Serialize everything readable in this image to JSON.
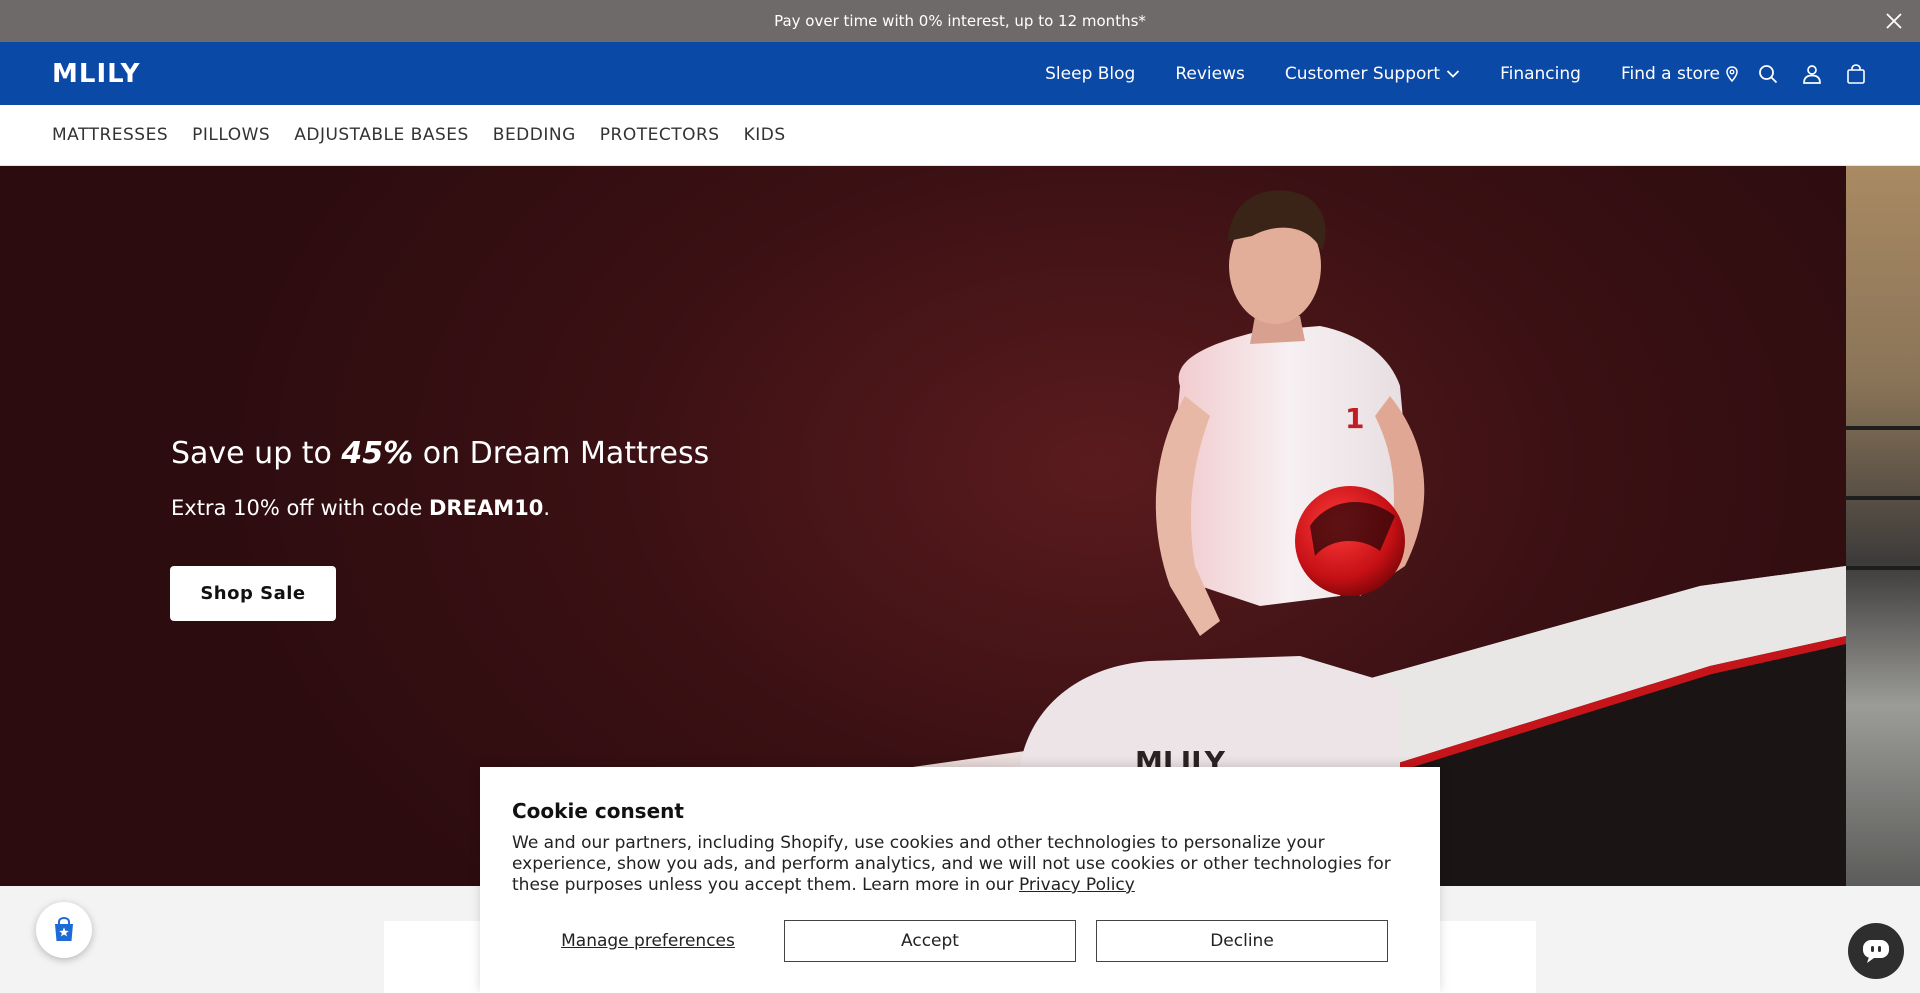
{
  "announcement": {
    "text": "Pay over time with 0% interest, up to 12 months*"
  },
  "brand": {
    "logo_text": "MLILY",
    "header_color": "#0b49a6"
  },
  "topnav": {
    "items": [
      {
        "label": "Sleep Blog"
      },
      {
        "label": "Reviews"
      },
      {
        "label": "Customer Support"
      },
      {
        "label": "Financing"
      },
      {
        "label": "Find a store"
      }
    ]
  },
  "categories": [
    "MATTRESSES",
    "PILLOWS",
    "ADJUSTABLE BASES",
    "BEDDING",
    "PROTECTORS",
    "KIDS"
  ],
  "hero": {
    "title_prefix": "Save up to ",
    "title_highlight": "45%",
    "title_suffix": " on Dream Mattress",
    "sub_prefix": "Extra 10% off with code ",
    "sub_code": "DREAM10",
    "sub_suffix": ".",
    "cta_label": "Shop Sale",
    "shirt_number": "1",
    "mattress_logo": "MLILY"
  },
  "cookie": {
    "title": "Cookie consent",
    "text": "We and our partners, including Shopify, use cookies and other technologies to personalize your experience, show you ads, and perform analytics, and we will not use cookies or other technologies for these purposes unless you accept them. Learn more in our ",
    "link_label": "Privacy Policy",
    "manage_label": "Manage preferences",
    "accept_label": "Accept",
    "decline_label": "Decline"
  },
  "icons": {
    "close": "close-icon",
    "chevron": "chevron-down-icon",
    "location": "location-pin-icon",
    "search": "search-icon",
    "account": "account-icon",
    "cart": "cart-icon",
    "shop": "shop-badge-icon",
    "chat": "chat-icon"
  }
}
